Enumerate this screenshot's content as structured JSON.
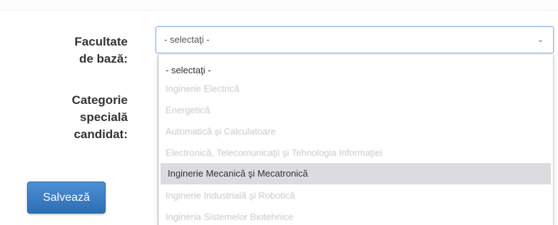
{
  "form": {
    "faculty_label_line1": "Facultate",
    "faculty_label_line2": "de bază:",
    "category_label_line1": "Categorie",
    "category_label_line2": "specială",
    "category_label_line3": "candidat:",
    "save_label": "Salvează"
  },
  "faculty_select": {
    "value": "- selectaţi -",
    "options": [
      "- selectaţi -",
      "Inginerie Electrică",
      "Energetică",
      "Automatică şi Calculatoare",
      "Electronică, Telecomunicaţii şi Tehnologia Informaţiei",
      "Inginerie Mecanică şi Mecatronică",
      "Inginerie Industrială şi Robotică",
      "Ingineria Sistemelor Biotehnice"
    ],
    "highlighted_index": 5
  },
  "colors": {
    "button": "#337ab7",
    "highlight": "#dcdce0",
    "focus_border": "#8fb3de"
  },
  "icons": {
    "select_arrow": "chevron-down-icon"
  }
}
